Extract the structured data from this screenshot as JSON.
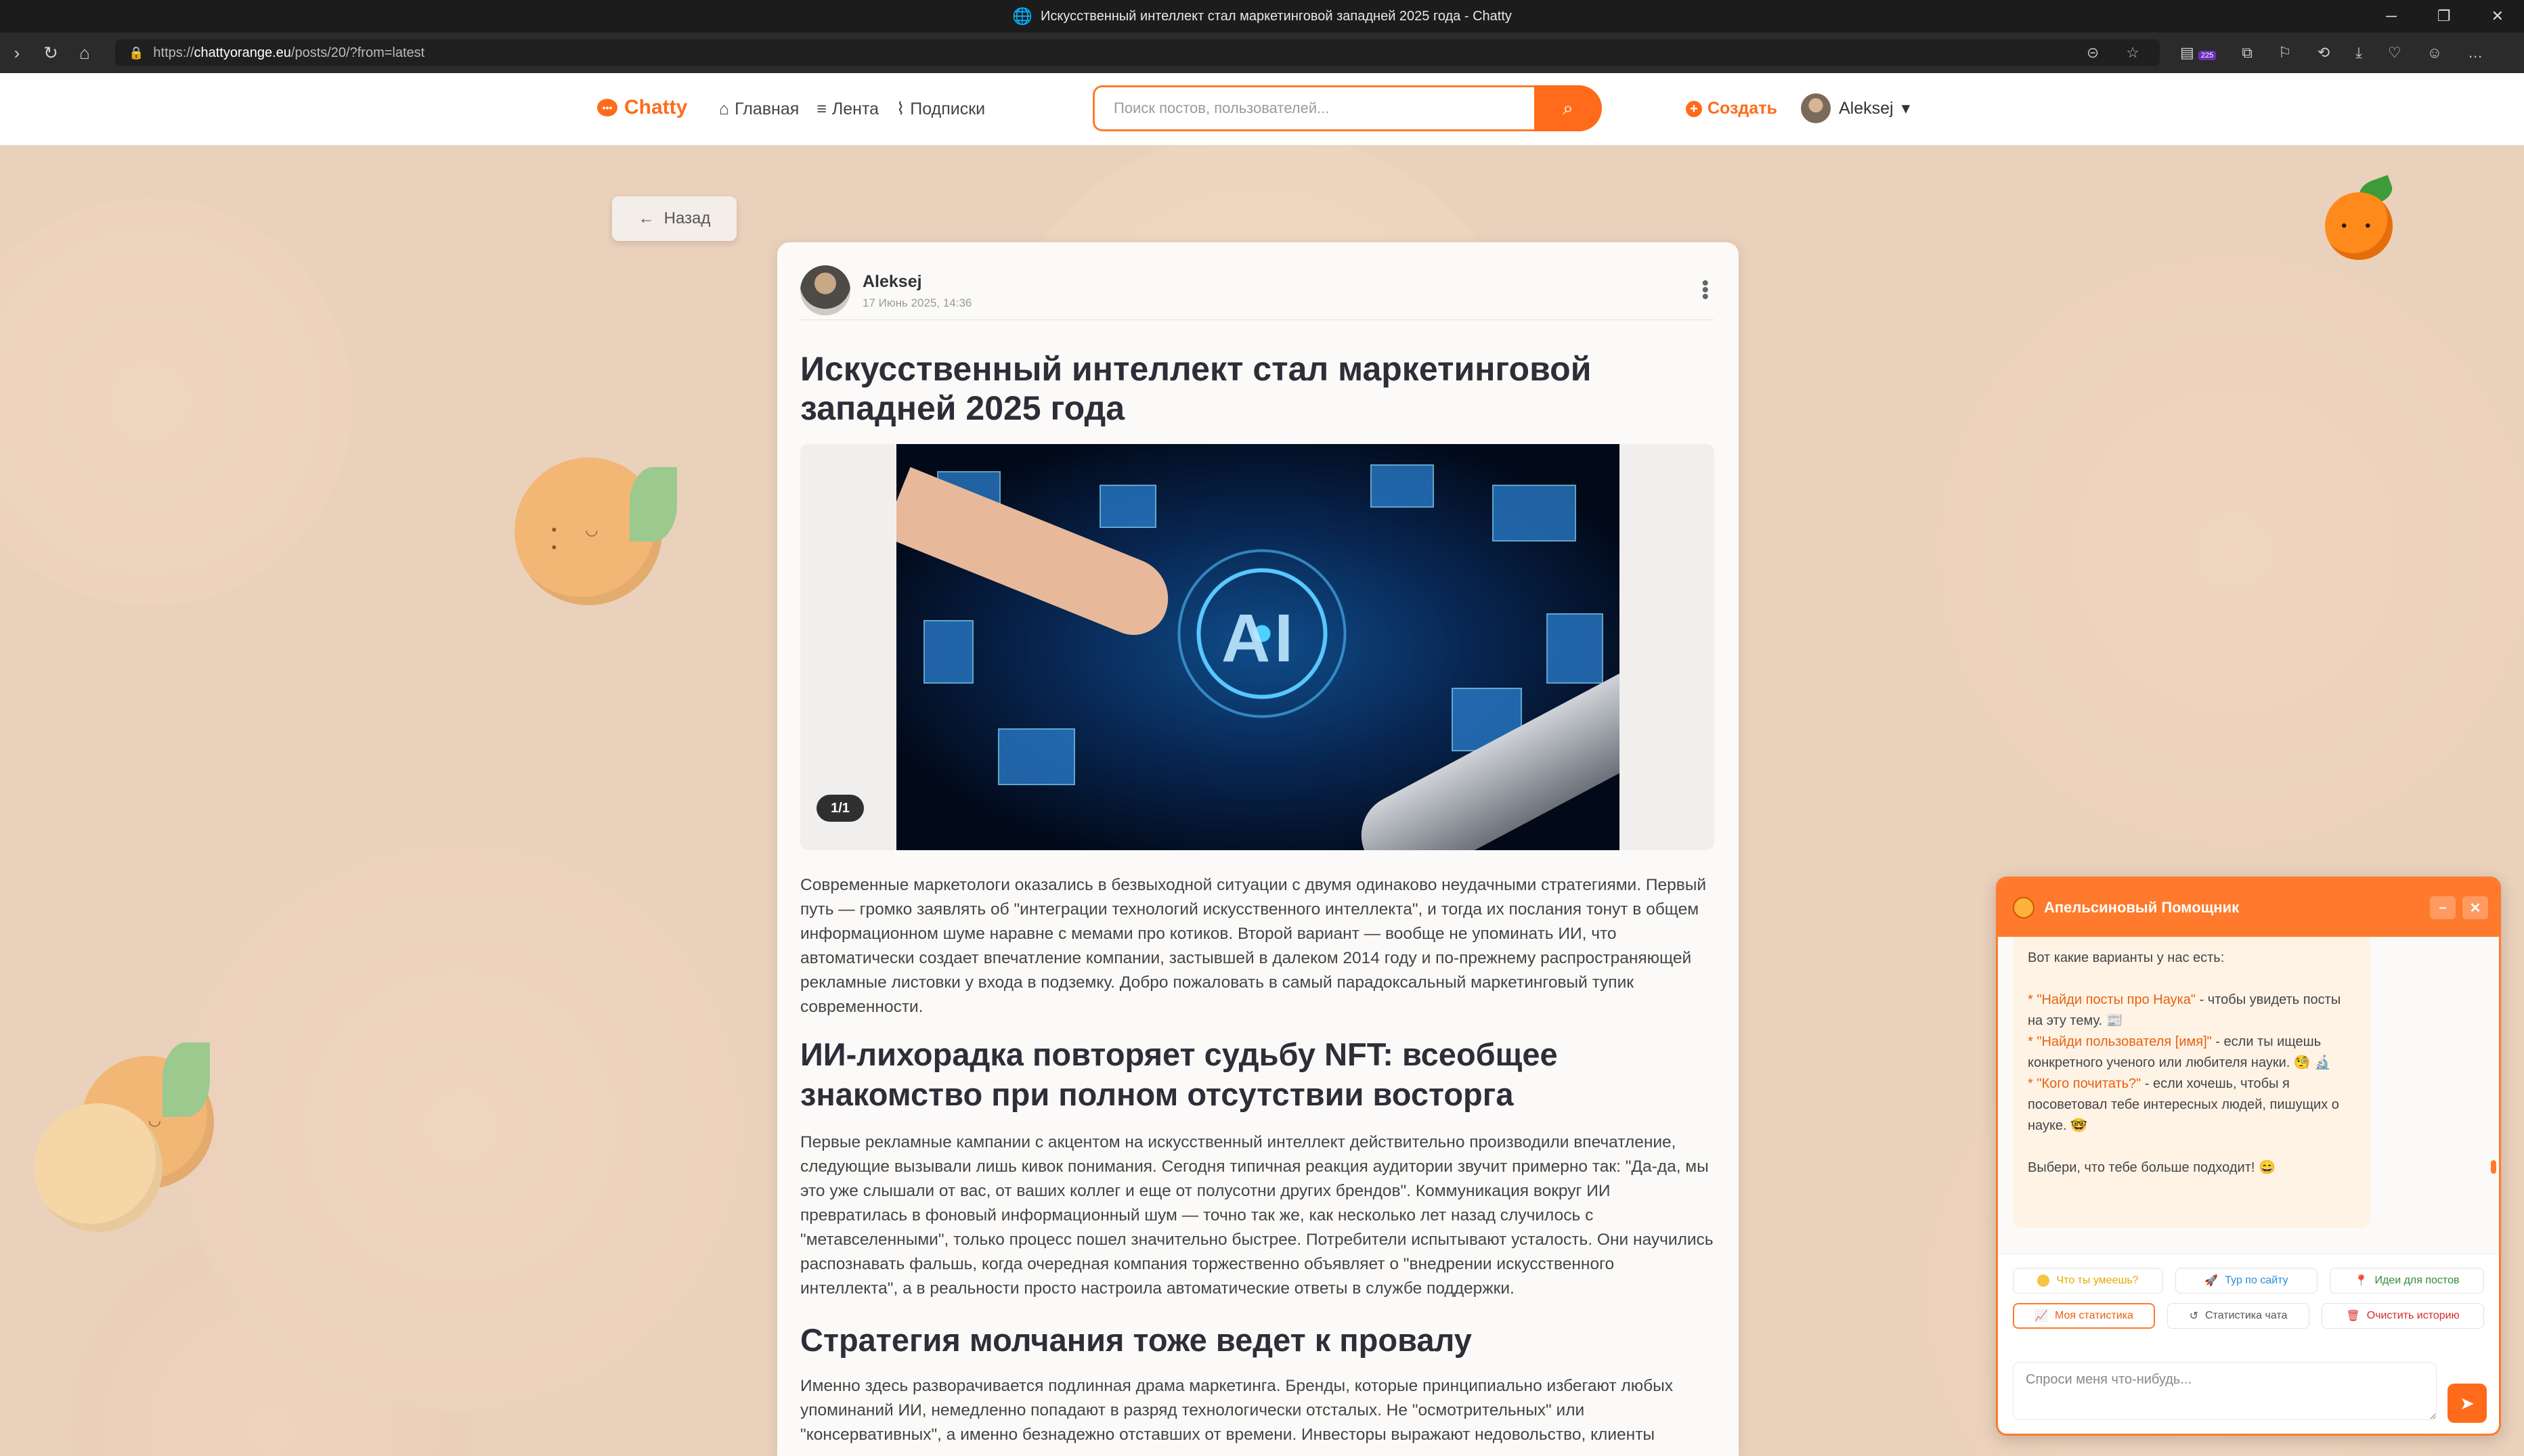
{
  "browser": {
    "window_title": "Искусственный интеллект стал маркетинговой западней 2025 года - Chatty",
    "url_prefix": "https://",
    "url_host": "chattyorange.eu",
    "url_path": "/posts/20/?from=latest",
    "extension_badge": "225"
  },
  "header": {
    "brand": "Chatty",
    "nav": [
      {
        "label": "Главная",
        "icon": "home-icon"
      },
      {
        "label": "Лента",
        "icon": "list-icon"
      },
      {
        "label": "Подписки",
        "icon": "rss-icon"
      }
    ],
    "search_placeholder": "Поиск постов, пользователей...",
    "create_label": "Создать",
    "user_name": "Aleksej"
  },
  "back_label": "Назад",
  "post": {
    "author": "Aleksej",
    "date": "17 Июнь 2025, 14:36",
    "title": "Искусственный интеллект стал маркетинговой западней 2025 года",
    "image_counter": "1/1",
    "image_text": "AI",
    "paragraph_1": "Современные маркетологи оказались в безвыходной ситуации с двумя одинаково неудачными стратегиями. Первый путь — громко заявлять об \"интеграции технологий искусственного интеллекта\", и тогда их послания тонут в общем информационном шуме наравне с мемами про котиков. Второй вариант — вообще не упоминать ИИ, что автоматически создает впечатление компании, застывшей в далеком 2014 году и по-прежнему распространяющей рекламные листовки у входа в подземку. Добро пожаловать в самый парадоксальный маркетинговый тупик современности.",
    "heading_2": "ИИ-лихорадка повторяет судьбу NFT: всеобщее знакомство при полном отсутствии восторга",
    "paragraph_2": "Первые рекламные кампании с акцентом на искусственный интеллект действительно производили впечатление, следующие вызывали лишь кивок понимания. Сегодня типичная реакция аудитории звучит примерно так: \"Да-да, мы это уже слышали от вас, от ваших коллег и еще от полусотни других брендов\". Коммуникация вокруг ИИ превратилась в фоновый информационный шум — точно так же, как несколько лет назад случилось с \"метавселенными\", только процесс пошел значительно быстрее. Потребители испытывают усталость. Они научились распознавать фальшь, когда очередная компания торжественно объявляет о \"внедрении искусственного интеллекта\", а в реальности просто настроила автоматические ответы в службе поддержки.",
    "heading_3": "Стратегия молчания тоже ведет к провалу",
    "paragraph_3": "Именно здесь разворачивается подлинная драма маркетинга. Бренды, которые принципиально избегают любых упоминаний ИИ, немедленно попадают в разряд технологически отсталых. Не \"осмотрительных\" или \"консервативных\", а именно безнадежно отставших от времени. Инвесторы выражают недовольство, клиенты"
  },
  "chat": {
    "title": "Апельсиновый Помощник",
    "intro": "Вот какие варианты у нас есть:",
    "options": [
      {
        "quote": "* \"Найди посты про Наука\"",
        "rest": " - чтобы увидеть посты на эту тему. 📰"
      },
      {
        "quote": "* \"Найди пользователя [имя]\"",
        "rest": " - если ты ищешь конкретного ученого или любителя науки. 🧐 🔬"
      },
      {
        "quote": "* \"Кого почитать?\"",
        "rest": " - если хочешь, чтобы я посоветовал тебе интересных людей, пишущих о науке. 🤓"
      }
    ],
    "outro": "Выбери, что тебе больше подходит! 😄",
    "quick_actions": [
      {
        "label": "Что ты умеешь?",
        "color": "#e6a800"
      },
      {
        "label": "Тур по сайту",
        "color": "#2a8fd8"
      },
      {
        "label": "Идеи для постов",
        "color": "#2f8a3c"
      },
      {
        "label": "Моя статистика",
        "color": "#e8610e"
      },
      {
        "label": "Статистика чата",
        "color": "#555555"
      },
      {
        "label": "Очистить историю",
        "color": "#d62a2a"
      }
    ],
    "input_placeholder": "Спроси меня что-нибудь..."
  }
}
